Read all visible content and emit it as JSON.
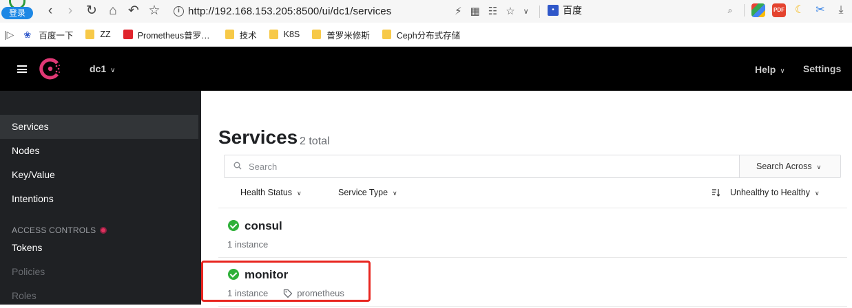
{
  "browser": {
    "login_label": "登录",
    "url": "http://192.168.153.205:8500/ui/dc1/services",
    "search_engine": "百度"
  },
  "bookmarks": [
    {
      "label": "百度一下",
      "icon": "paw-icon"
    },
    {
      "label": "ZZ",
      "icon": "folder-icon"
    },
    {
      "label": "Prometheus普罗…",
      "icon": "prometheus-icon"
    },
    {
      "label": "技术",
      "icon": "folder-icon"
    },
    {
      "label": "K8S",
      "icon": "folder-icon"
    },
    {
      "label": "普罗米修斯",
      "icon": "folder-icon"
    },
    {
      "label": "Ceph分布式存储",
      "icon": "folder-icon"
    }
  ],
  "header": {
    "datacenter": "dc1",
    "help_label": "Help",
    "settings_label": "Settings",
    "brand_color": "#e03875"
  },
  "sidebar": {
    "items": [
      {
        "label": "Services",
        "active": true
      },
      {
        "label": "Nodes"
      },
      {
        "label": "Key/Value"
      },
      {
        "label": "Intentions"
      }
    ],
    "section_label": "ACCESS CONTROLS",
    "acl_items": [
      {
        "label": "Tokens"
      },
      {
        "label": "Policies",
        "disabled": true
      },
      {
        "label": "Roles",
        "disabled": true
      }
    ]
  },
  "main": {
    "title": "Services",
    "count": "2 total",
    "search_placeholder": "Search",
    "search_across_label": "Search Across",
    "filters": {
      "health_status": "Health Status",
      "service_type": "Service Type",
      "sort": "Unhealthy to Healthy"
    },
    "services": [
      {
        "name": "consul",
        "instances": "1 instance",
        "status": "passing"
      },
      {
        "name": "monitor",
        "instances": "1 instance",
        "tag": "prometheus",
        "status": "passing"
      }
    ]
  }
}
